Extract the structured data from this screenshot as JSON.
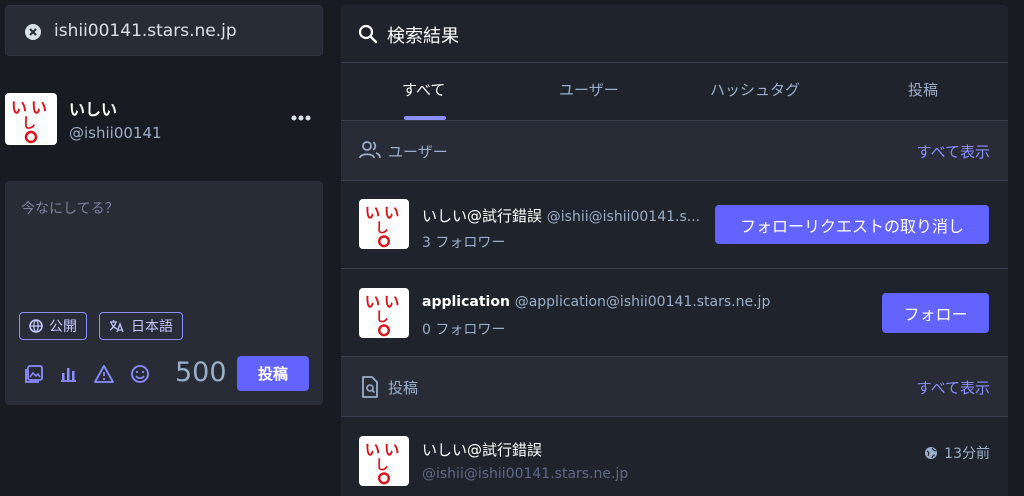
{
  "search": {
    "query": "ishii00141.stars.ne.jp"
  },
  "profile": {
    "display_name": "いしい",
    "acct": "@ishii00141",
    "avatar": "いしい avatar"
  },
  "compose": {
    "placeholder": "今なにしてる？",
    "visibility": "公開",
    "language": "日本語",
    "char_count": "500",
    "post_label": "投稿"
  },
  "results": {
    "title": "検索結果",
    "tabs": [
      "すべて",
      "ユーザー",
      "ハッシュタグ",
      "投稿"
    ],
    "users_section": {
      "title": "ユーザー",
      "show_all": "すべて表示"
    },
    "users": [
      {
        "name": "いしい@試行錯誤",
        "acct": "@ishii@ishii00141.s...",
        "followers": "3 フォロワー",
        "button": "フォローリクエストの取り消し"
      },
      {
        "name": "application",
        "acct": "@application@ishii00141.stars.ne.jp",
        "followers": "0 フォロワー",
        "button": "フォロー"
      }
    ],
    "posts_section": {
      "title": "投稿",
      "show_all": "すべて表示"
    },
    "posts": [
      {
        "name": "いしい@試行錯誤",
        "acct": "@ishii@ishii00141.stars.ne.jp",
        "time": "13分前"
      }
    ]
  },
  "colors": {
    "accent": "#6364ff",
    "bg": "#191b22",
    "panel": "#1f232b"
  }
}
